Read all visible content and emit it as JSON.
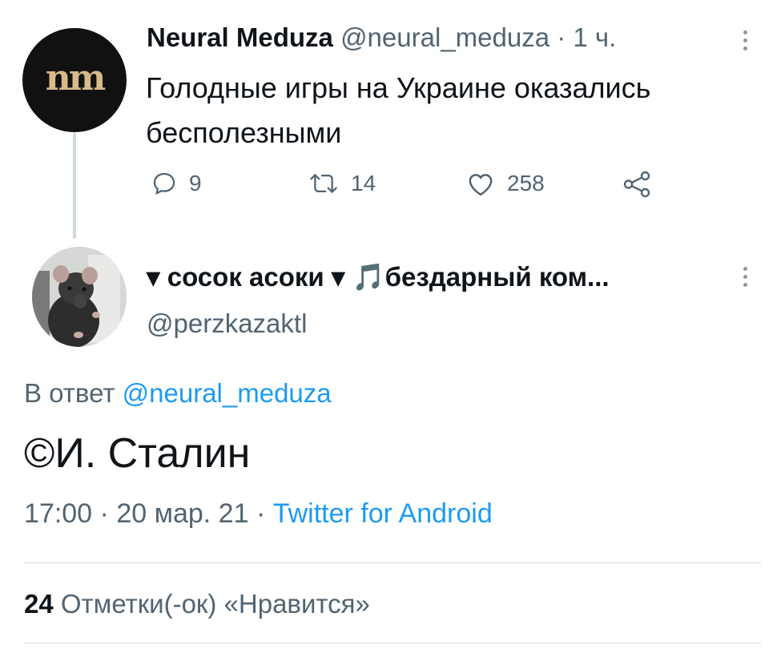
{
  "tweet1": {
    "avatar_text": "nm",
    "name": "Neural Meduza",
    "handle": "@neural_meduza",
    "time": "1 ч.",
    "text": "Голодные игры на Украине оказались бесполезными",
    "replies": "9",
    "retweets": "14",
    "likes": "258"
  },
  "tweet2": {
    "name": "▾ сосок асоки ▾ 🎵бездарный ком...",
    "handle": "@perzkazaktl",
    "reply_prefix": "В ответ",
    "reply_handle": "@neural_meduza",
    "text": "©И. Сталин",
    "time": "17:00",
    "date": "20 мар. 21",
    "source": "Twitter for Android",
    "likes_count": "24",
    "likes_label": "Отметки(-ок) «Нравится»"
  },
  "icons": [
    "reply-icon",
    "retweet-icon",
    "like-icon",
    "share-icon",
    "more-icon"
  ],
  "colors": {
    "link": "#1d9bf0",
    "secondary": "#536471",
    "text": "#0f1419"
  }
}
